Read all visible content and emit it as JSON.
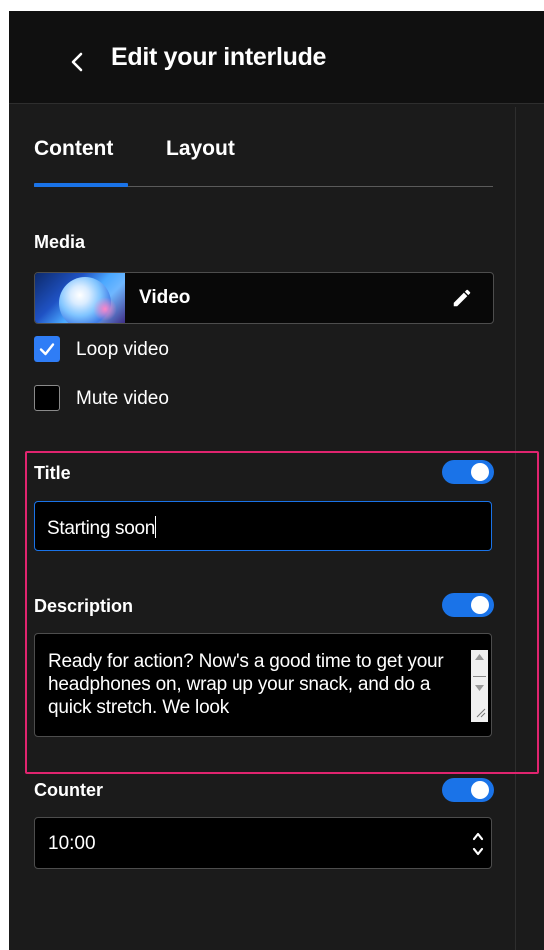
{
  "header": {
    "back_label": "Back",
    "title": "Edit your interlude"
  },
  "tabs": [
    {
      "label": "Content",
      "active": true
    },
    {
      "label": "Layout",
      "active": false
    }
  ],
  "media": {
    "section_label": "Media",
    "type_label": "Video",
    "loop": {
      "label": "Loop video",
      "checked": true
    },
    "mute": {
      "label": "Mute video",
      "checked": false
    }
  },
  "title_field": {
    "section_label": "Title",
    "enabled": true,
    "value": "Starting soon"
  },
  "description_field": {
    "section_label": "Description",
    "enabled": true,
    "value": "Ready for action? Now's a good time to get your headphones on, wrap up your snack, and do a quick stretch. We look"
  },
  "counter_field": {
    "section_label": "Counter",
    "enabled": true,
    "value": "10:00"
  },
  "colors": {
    "accent": "#1a73e8",
    "highlight": "#e0246f",
    "panel": "#1b1b1b",
    "header": "#101010"
  },
  "icons": {
    "back": "chevron-left-icon",
    "edit": "pencil-icon",
    "check": "check-icon",
    "spinner": "up-down-chevron-icon"
  }
}
